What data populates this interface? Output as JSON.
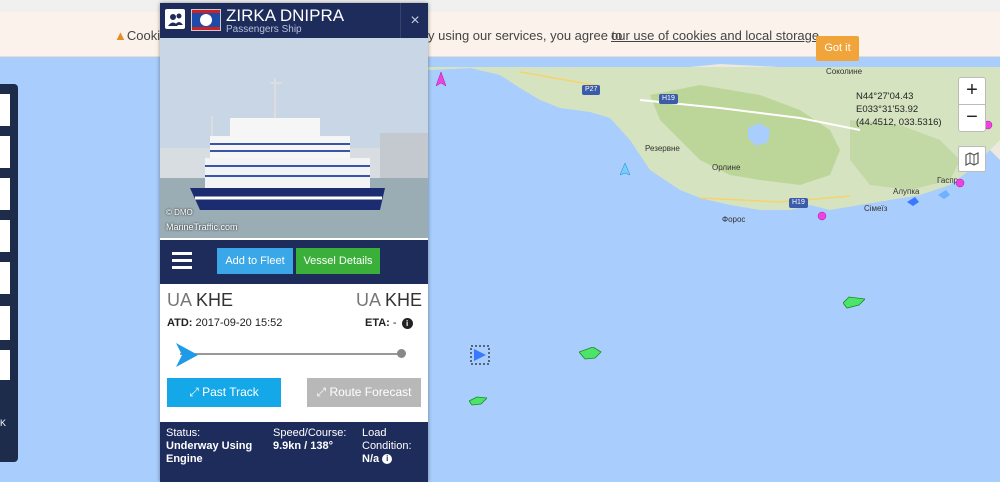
{
  "cookies": {
    "text_visible": "Cooki",
    "text_middle": "y using our services, you agree to",
    "link": "our use of cookies and local storage",
    "period": ".",
    "button": "Got it"
  },
  "map": {
    "places": {
      "sokolyne": "Соколине",
      "rezervne": "Резервне",
      "orlyne": "Орлине",
      "alupka": "Алупка",
      "simeiz": "Сімеїз",
      "foros": "Форос",
      "gaspra": "Гаспр"
    },
    "roads": {
      "p27": "P27",
      "h19a": "H19",
      "h19b": "H19"
    },
    "coordinates": {
      "lat": "N44°27'04.43",
      "lon": "E033°31'53.92",
      "decimal": "(44.4512, 033.5316)"
    },
    "zoom_in": "+",
    "zoom_out": "−",
    "left_label": "K"
  },
  "popup": {
    "name": "ZIRKA DNIPRA",
    "type": "Passengers Ship",
    "close": "×",
    "photo_credit_copyright": "© DMO",
    "photo_credit_site": "MarineTraffic.com",
    "add_to_fleet": "Add to Fleet",
    "vessel_details": "Vessel Details",
    "from_country": "UA",
    "from_port": "KHE",
    "to_country": "UA",
    "to_port": "KHE",
    "atd_label": "ATD:",
    "atd_value": "2017-09-20 15:52",
    "eta_label": "ETA:",
    "eta_value": "-",
    "past_track": "Past Track",
    "route_forecast": "Route Forecast",
    "status_label": "Status:",
    "status_value": "Underway Using Engine",
    "speed_label": "Speed/Course:",
    "speed_value": "9.9kn / 138°",
    "load_label": "Load Condition:",
    "load_value": "N/a"
  }
}
